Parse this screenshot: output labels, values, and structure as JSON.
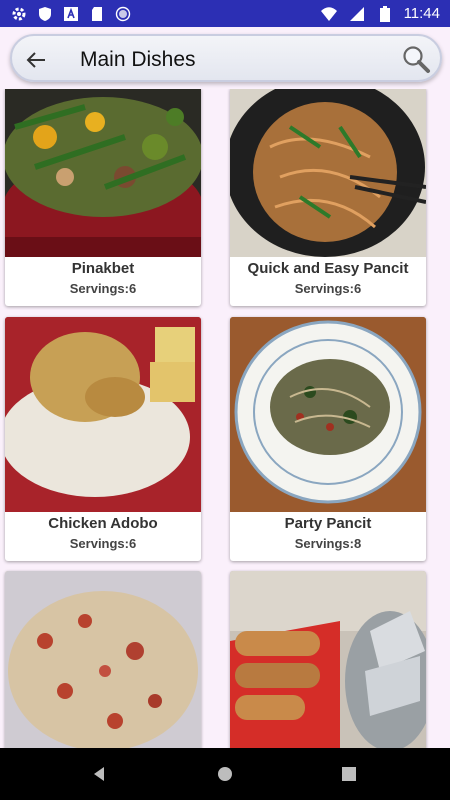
{
  "status_bar": {
    "time": "11:44",
    "icons": [
      "settings-icon",
      "shield-icon",
      "font-a-icon",
      "sd-card-icon",
      "circle-icon",
      "wifi-icon",
      "cell-signal-icon",
      "battery-icon"
    ]
  },
  "app_bar": {
    "title": "Main Dishes",
    "back_icon": "arrow-back-icon",
    "search_icon": "search-icon"
  },
  "dishes": [
    {
      "name": "Pinakbet",
      "servings": "Servings:6"
    },
    {
      "name": "Quick and Easy Pancit",
      "servings": "Servings:6"
    },
    {
      "name": "Chicken Adobo",
      "servings": "Servings:6"
    },
    {
      "name": "Party Pancit",
      "servings": "Servings:8"
    },
    {
      "name": "",
      "servings": ""
    },
    {
      "name": "",
      "servings": ""
    }
  ],
  "nav_bar": {
    "back": "nav-back-icon",
    "home": "nav-home-icon",
    "recents": "nav-recents-icon"
  },
  "colors": {
    "status_bar": "#2c2fb4",
    "background": "#faf0fb",
    "nav_bar": "#000000"
  }
}
